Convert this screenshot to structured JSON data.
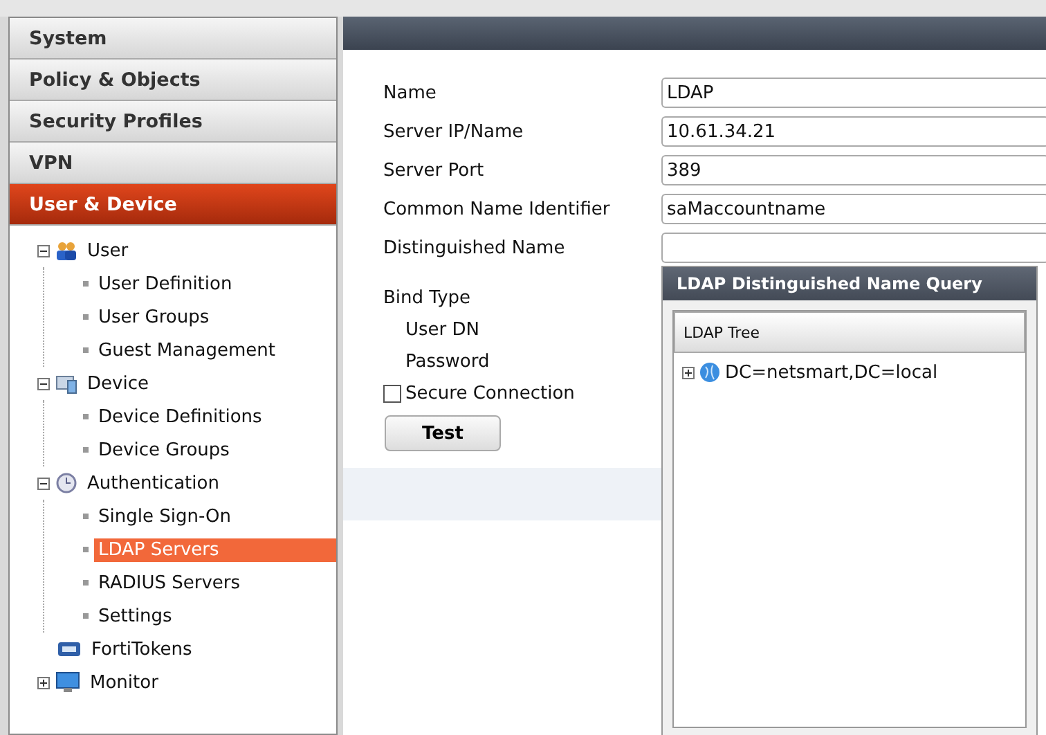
{
  "nav": [
    {
      "label": "System",
      "selected": false
    },
    {
      "label": "Policy & Objects",
      "selected": false
    },
    {
      "label": "Security Profiles",
      "selected": false
    },
    {
      "label": "VPN",
      "selected": false
    },
    {
      "label": "User & Device",
      "selected": true
    }
  ],
  "tree": [
    {
      "label": "User",
      "expanded": true,
      "children": [
        {
          "label": "User Definition",
          "selected": false
        },
        {
          "label": "User Groups",
          "selected": false
        },
        {
          "label": "Guest Management",
          "selected": false
        }
      ]
    },
    {
      "label": "Device",
      "expanded": true,
      "children": [
        {
          "label": "Device Definitions",
          "selected": false
        },
        {
          "label": "Device Groups",
          "selected": false
        }
      ]
    },
    {
      "label": "Authentication",
      "expanded": true,
      "children": [
        {
          "label": "Single Sign-On",
          "selected": false
        },
        {
          "label": "LDAP Servers",
          "selected": true
        },
        {
          "label": "RADIUS Servers",
          "selected": false
        },
        {
          "label": "Settings",
          "selected": false
        }
      ]
    },
    {
      "label": "FortiTokens"
    },
    {
      "label": "Monitor",
      "expanded": false
    }
  ],
  "form": {
    "fields": [
      {
        "label": "Name",
        "value": "LDAP"
      },
      {
        "label": "Server IP/Name",
        "value": "10.61.34.21"
      },
      {
        "label": "Server Port",
        "value": "389"
      },
      {
        "label": "Common Name Identifier",
        "value": "saMaccountname"
      },
      {
        "label": "Distinguished Name"
      }
    ],
    "bind_type": {
      "label": "Bind Type"
    },
    "sub_labels": [
      "User DN",
      "Password"
    ],
    "secure_connection": {
      "label": "Secure Connection",
      "checked": false
    },
    "test_button": "Test"
  },
  "dialog": {
    "title": "LDAP Distinguished Name Query",
    "column": "LDAP Tree",
    "nodes": [
      {
        "label": "DC=netsmart,DC=local",
        "expanded": false
      }
    ]
  }
}
